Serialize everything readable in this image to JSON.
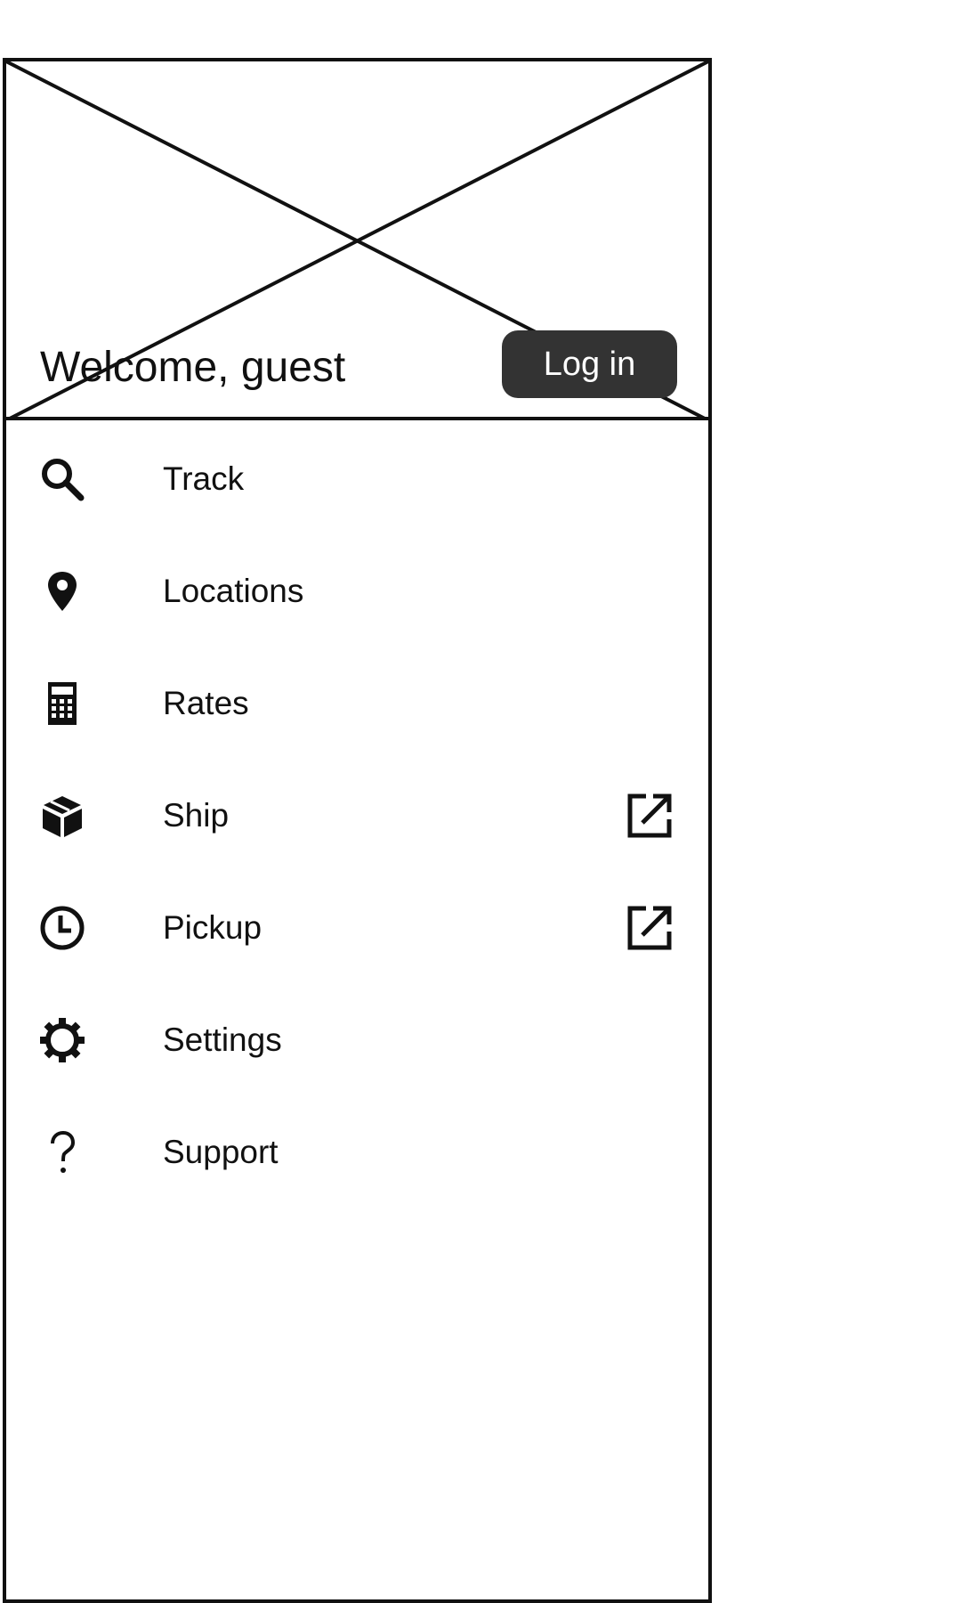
{
  "header": {
    "welcome_text": "Welcome, guest",
    "login_label": "Log in"
  },
  "menu": {
    "items": [
      {
        "label": "Track",
        "icon": "search-icon",
        "external": false
      },
      {
        "label": "Locations",
        "icon": "location-pin-icon",
        "external": false
      },
      {
        "label": "Rates",
        "icon": "calculator-icon",
        "external": false
      },
      {
        "label": "Ship",
        "icon": "package-icon",
        "external": true
      },
      {
        "label": "Pickup",
        "icon": "clock-icon",
        "external": true
      },
      {
        "label": "Settings",
        "icon": "gear-icon",
        "external": false
      },
      {
        "label": "Support",
        "icon": "help-icon",
        "external": false
      }
    ]
  },
  "colors": {
    "button_background": "#333333",
    "button_text": "#ffffff",
    "border": "#111111"
  }
}
